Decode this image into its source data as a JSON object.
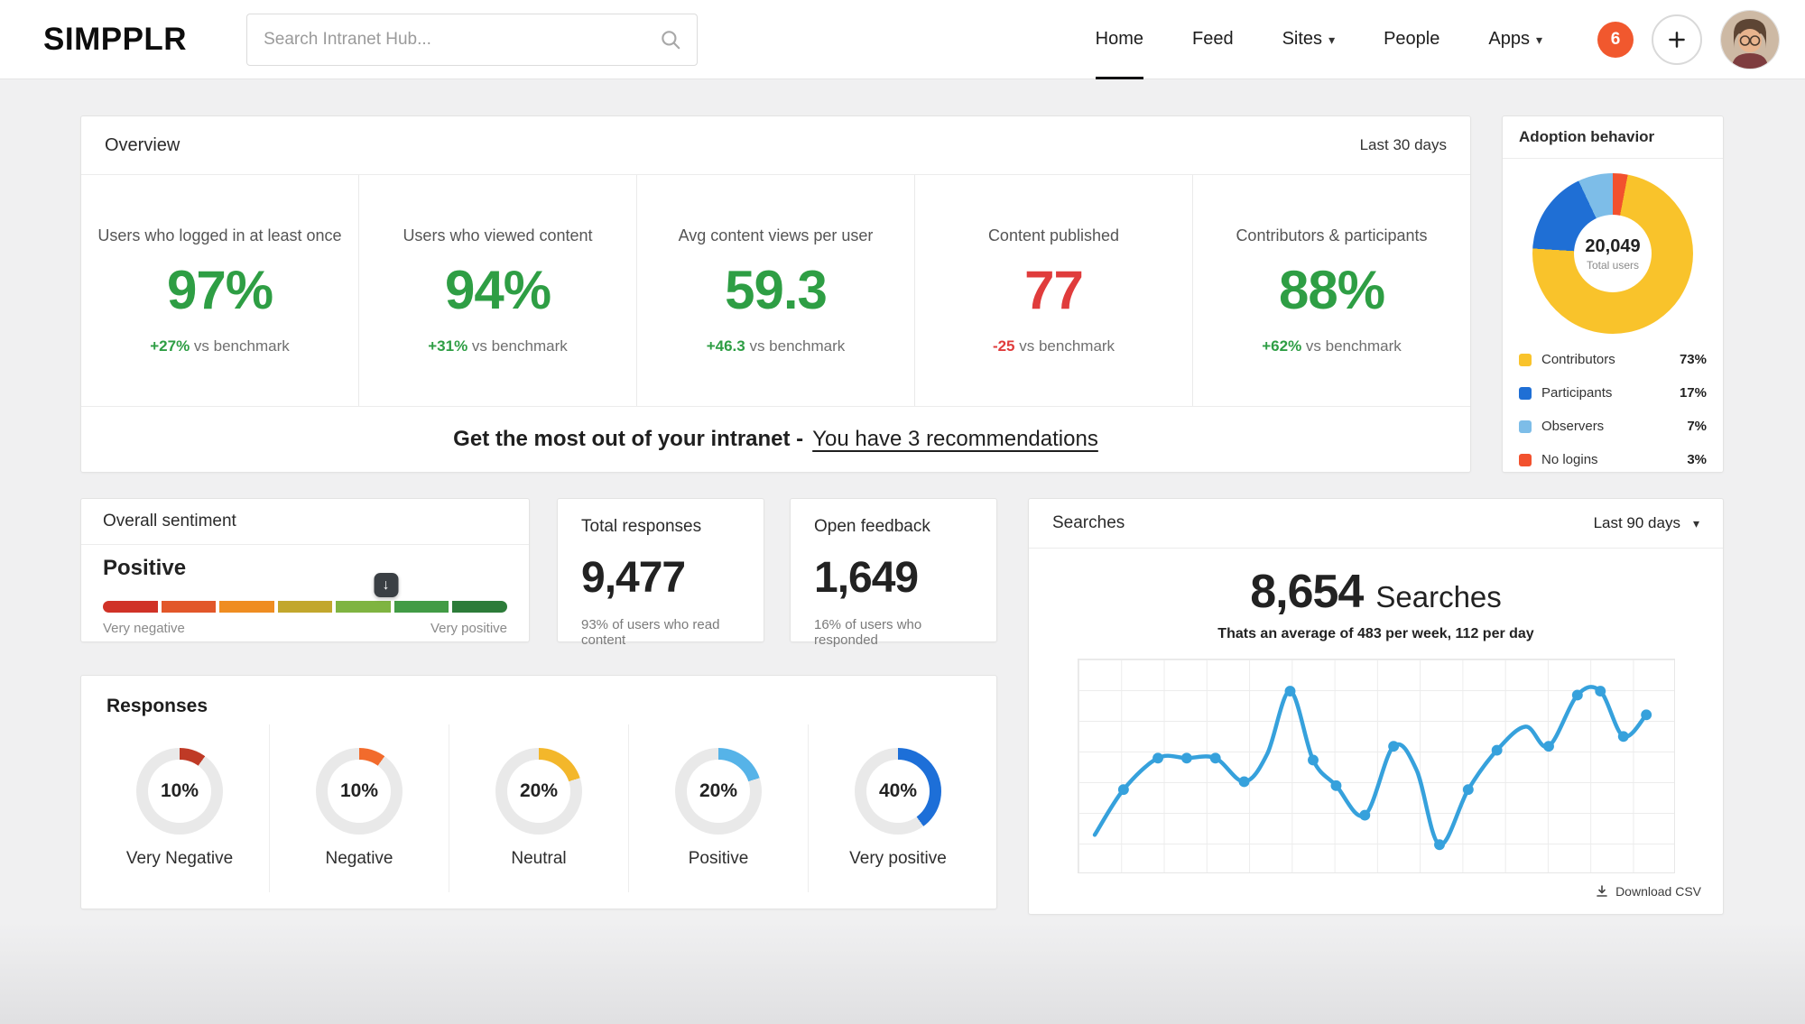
{
  "header": {
    "logo": "SIMPPLR",
    "search": {
      "placeholder": "Search Intranet Hub..."
    },
    "nav": [
      {
        "label": "Home",
        "active": true,
        "caret": false
      },
      {
        "label": "Feed",
        "active": false,
        "caret": false
      },
      {
        "label": "Sites",
        "active": false,
        "caret": true
      },
      {
        "label": "People",
        "active": false,
        "caret": false
      },
      {
        "label": "Apps",
        "active": false,
        "caret": true
      }
    ],
    "notification_count": "6"
  },
  "icons": {
    "chevron_down": "▾",
    "arrow_down": "↓",
    "search": "magnifier",
    "plus": "plus",
    "download": "download-arrow"
  },
  "overview": {
    "title": "Overview",
    "period": "Last 30 days",
    "metrics": [
      {
        "label": "Users who logged in at least once",
        "value": "97%",
        "value_color": "#2e9e44",
        "delta": "+27%",
        "suffix": " vs benchmark",
        "delta_color": "#2e9e44"
      },
      {
        "label": "Users who viewed content",
        "value": "94%",
        "value_color": "#2e9e44",
        "delta": "+31%",
        "suffix": " vs benchmark",
        "delta_color": "#2e9e44"
      },
      {
        "label": "Avg content views per user",
        "value": "59.3",
        "value_color": "#2e9e44",
        "delta": "+46.3",
        "suffix": " vs benchmark",
        "delta_color": "#2e9e44"
      },
      {
        "label": "Content published",
        "value": "77",
        "value_color": "#e03c3c",
        "delta": "-25",
        "suffix": " vs benchmark",
        "delta_color": "#e03c3c"
      },
      {
        "label": "Contributors & participants",
        "value": "88%",
        "value_color": "#2e9e44",
        "delta": "+62%",
        "suffix": " vs benchmark",
        "delta_color": "#2e9e44"
      }
    ],
    "recommendation": {
      "prefix": "Get the most out of your intranet -",
      "link": "You have 3 recommendations"
    }
  },
  "adoption": {
    "title": "Adoption behavior"
  },
  "sentiment": {
    "title": "Overall sentiment",
    "value_label": "Positive",
    "marker_pos_pct": 70,
    "bar_colors": [
      "#d03227",
      "#e2572a",
      "#ef8d21",
      "#c2a72d",
      "#7fb441",
      "#429b45",
      "#2c7c39"
    ],
    "scale_min_label": "Very negative",
    "scale_max_label": "Very positive"
  },
  "total_responses": {
    "title": "Total responses",
    "value": "9,477",
    "caption": "93% of users who read content"
  },
  "open_feedback": {
    "title": "Open feedback",
    "value": "1,649",
    "caption": "16% of users who responded"
  },
  "searches": {
    "title": "Searches",
    "period": "Last 90 days",
    "big_value": "8,654",
    "big_suffix": "Searches",
    "subtitle": "Thats an average of 483 per week, 112 per day",
    "download_label": "Download CSV"
  },
  "responses": {
    "title": "Responses"
  },
  "chart_data": [
    {
      "id": "adoption_donut",
      "type": "pie",
      "title": "Adoption behavior",
      "center_value": "20,049",
      "center_label": "Total users",
      "segments": [
        {
          "label": "Contributors",
          "value": 73,
          "pct": "73%",
          "color": "#f9c32b"
        },
        {
          "label": "Participants",
          "value": 17,
          "pct": "17%",
          "color": "#1f6fd5"
        },
        {
          "label": "Observers",
          "value": 7,
          "pct": "7%",
          "color": "#7dbde8"
        },
        {
          "label": "No logins",
          "value": 3,
          "pct": "3%",
          "color": "#f2512e"
        }
      ],
      "draw_order_from_top": [
        "No logins",
        "Contributors",
        "Participants",
        "Observers"
      ]
    },
    {
      "id": "responses_gauges",
      "type": "pie",
      "title": "Responses",
      "items": [
        {
          "label": "Very Negative",
          "value": 10,
          "pct": "10%",
          "color": "#bf3a26"
        },
        {
          "label": "Negative",
          "value": 10,
          "pct": "10%",
          "color": "#f26b2c"
        },
        {
          "label": "Neutral",
          "value": 20,
          "pct": "20%",
          "color": "#f3b72b"
        },
        {
          "label": "Positive",
          "value": 20,
          "pct": "20%",
          "color": "#56b3e8"
        },
        {
          "label": "Very positive",
          "value": 40,
          "pct": "40%",
          "color": "#1d6fd8"
        }
      ]
    },
    {
      "id": "searches_line",
      "type": "line",
      "title": "Searches",
      "color": "#36a1dc",
      "grid": true,
      "points_format": "[x_pct, y_pct_from_top, has_dot]",
      "points": [
        [
          1,
          85,
          0
        ],
        [
          6,
          62,
          1
        ],
        [
          12,
          46,
          1
        ],
        [
          17,
          46,
          1
        ],
        [
          22,
          46,
          1
        ],
        [
          27,
          58,
          1
        ],
        [
          31,
          44,
          0
        ],
        [
          35,
          12,
          1
        ],
        [
          39,
          47,
          1
        ],
        [
          43,
          60,
          1
        ],
        [
          48,
          75,
          1
        ],
        [
          53,
          40,
          1
        ],
        [
          57,
          52,
          0
        ],
        [
          61,
          90,
          1
        ],
        [
          66,
          62,
          1
        ],
        [
          71,
          42,
          1
        ],
        [
          76,
          30,
          0
        ],
        [
          80,
          40,
          1
        ],
        [
          85,
          14,
          1
        ],
        [
          89,
          12,
          1
        ],
        [
          93,
          35,
          1
        ],
        [
          97,
          24,
          1
        ]
      ]
    }
  ]
}
